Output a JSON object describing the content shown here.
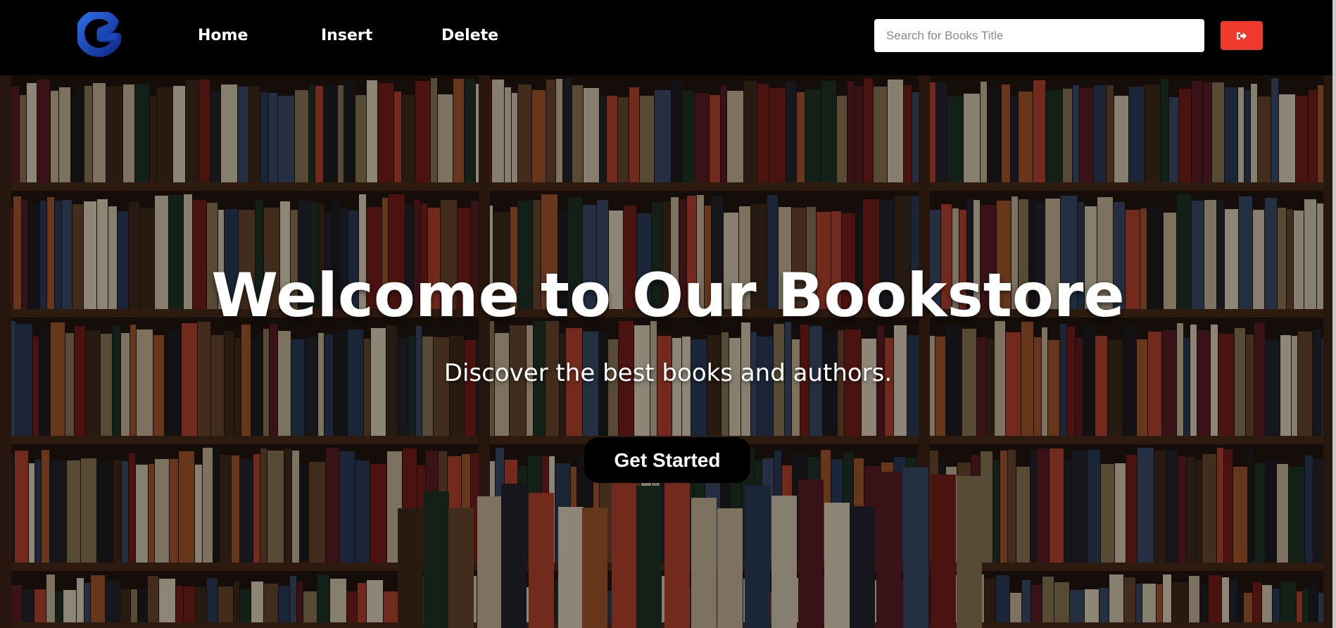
{
  "nav": {
    "logo_icon": "g-logo-icon",
    "links": [
      {
        "label": "Home"
      },
      {
        "label": "Insert"
      },
      {
        "label": "Delete"
      }
    ],
    "search": {
      "placeholder": "Search for Books Title",
      "value": ""
    },
    "logout_icon": "sign-out-icon",
    "logout_color": "#f03a2e"
  },
  "hero": {
    "title": "Welcome to Our Bookstore",
    "subtitle": "Discover the best books and authors.",
    "cta_label": "Get Started",
    "background": "bookshelf-photo"
  },
  "colors": {
    "navbar": "#000000",
    "logo_blue": "#1a56c9",
    "cta_background": "#000000"
  }
}
